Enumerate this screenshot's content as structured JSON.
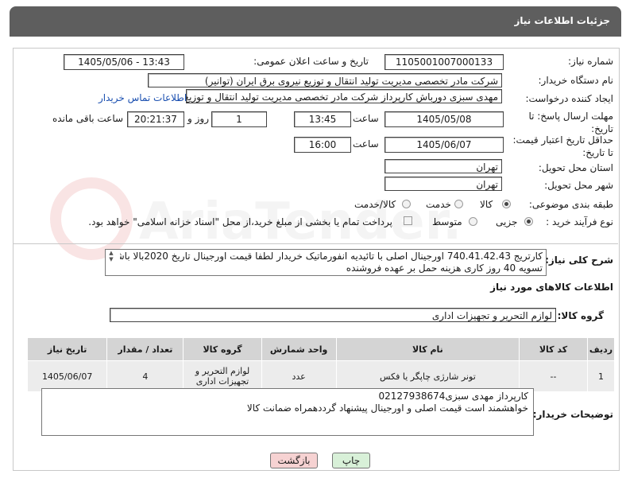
{
  "header": {
    "title": "جزئیات اطلاعات نیاز"
  },
  "fields": {
    "need_number_label": "شماره نیاز:",
    "need_number": "1105001007000133",
    "announce_label": "تاریخ و ساعت اعلان عمومی:",
    "announce_value": "1405/05/06 - 13:43",
    "buyer_label": "نام دستگاه خریدار:",
    "buyer_value": "شرکت مادر تخصصی مدیریت تولید  انتقال و توزیع نیروی برق ایران (توانیر)",
    "creator_label": "ایجاد کننده درخواست:",
    "creator_value": "مهدی سبزی دورباش کارپرداز شرکت مادر تخصصی مدیریت تولید  انتقال و توزیع ن",
    "contact_link": "اطلاعات تماس خریدار",
    "deadline_label": "مهلت ارسال پاسخ: تا تاریخ:",
    "deadline_date": "1405/05/08",
    "hour_label": "ساعت",
    "deadline_time": "13:45",
    "days_value": "1",
    "days_label": "روز و",
    "remaining_time": "20:21:37",
    "remaining_label": "ساعت باقی مانده",
    "validity_label": "حداقل تاریخ اعتبار قیمت: تا تاریخ:",
    "validity_date": "1405/06/07",
    "validity_hour_label": "ساعت",
    "validity_time": "16:00",
    "province_label": "استان محل تحویل:",
    "province_value": "تهران",
    "city_label": "شهر محل تحویل:",
    "city_value": "تهران",
    "category_label": "طبقه بندی موضوعی:",
    "category_options": [
      "کالا",
      "خدمت",
      "کالا/خدمت"
    ],
    "category_selected": "کالا",
    "process_label": "نوع فرآیند خرید :",
    "process_options": [
      "جزیی",
      "متوسط"
    ],
    "process_selected": "جزیی",
    "payment_note": "پرداخت تمام یا بخشی از مبلغ خرید،از محل \"اسناد خزانه اسلامی\" خواهد بود.",
    "desc_label": "شرح کلی نیاز:",
    "desc_line1": "کارتریج 740.41.42.43 اورجینال اصلی با تائیدیه انفورماتیک خریدار لطفا قیمت اورجینال تاریخ 2020بالا باشد",
    "desc_line2": "تسویه 40 روز کاری هزینه حمل بر عهده فروشنده",
    "goods_info_title": "اطلاعات کالاهای مورد نیاز",
    "goods_group_label": "گروه کالا:",
    "goods_group_value": "لوازم التحریر و تجهیزات اداری",
    "buyer_notes_label": "توضیحات خریدار:",
    "buyer_notes_line1": "کارپرداز مهدی سبزی02127938674",
    "buyer_notes_line2": "خواهشمند است قیمت اصلی و اورجینال پیشنهاد گرددهمراه ضمانت کالا"
  },
  "table": {
    "headers": [
      "ردیف",
      "کد کالا",
      "نام کالا",
      "واحد شمارش",
      "گروه کالا",
      "تعداد / مقدار",
      "تاریخ نیاز"
    ],
    "rows": [
      [
        "1",
        "--",
        "تونر شارژی چاپگر یا فکس",
        "عدد",
        "لوازم التحریر و تجهیزات اداری",
        "4",
        "1405/06/07"
      ]
    ]
  },
  "buttons": {
    "print": "چاپ",
    "back": "بازگشت"
  },
  "watermark_text": "AriaTender.neT",
  "colors": {
    "header_bg": "#5e5e5e",
    "print_btn": "#d8f0d8",
    "back_btn": "#f6d2d2",
    "link": "#1a4fb0"
  }
}
